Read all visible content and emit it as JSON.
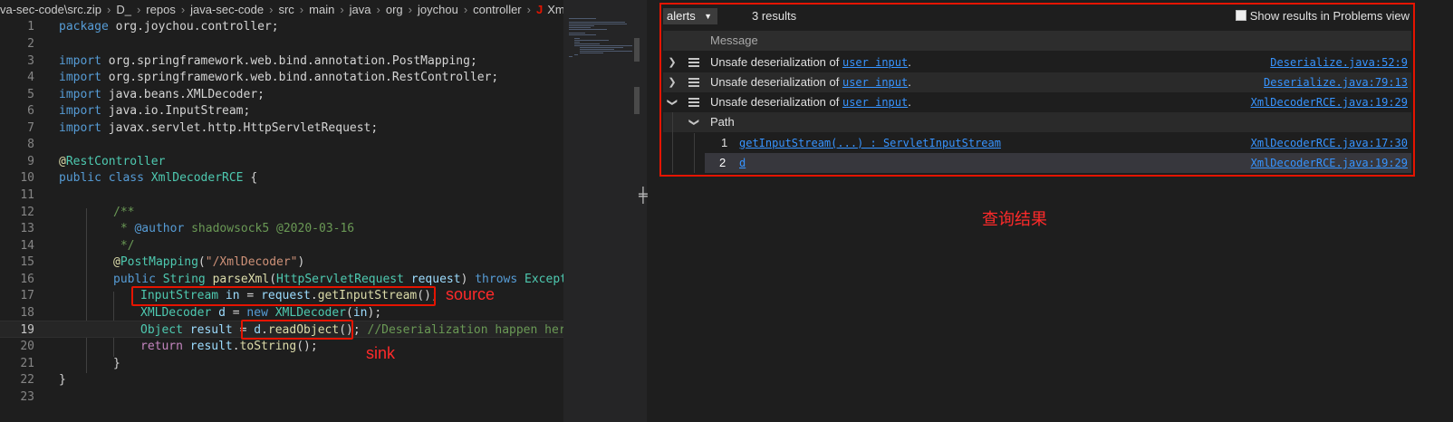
{
  "breadcrumb": {
    "items": [
      "va-sec-code\\src.zip",
      "D_",
      "repos",
      "java-sec-code",
      "src",
      "main",
      "java",
      "org",
      "joychou",
      "controller"
    ],
    "file_icon": "J",
    "file": "XmlDecoderRCE.java"
  },
  "code": {
    "line_numbers": [
      "1",
      "2",
      "3",
      "4",
      "5",
      "6",
      "7",
      "8",
      "9",
      "10",
      "11",
      "12",
      "13",
      "14",
      "15",
      "16",
      "17",
      "18",
      "19",
      "20",
      "21",
      "22",
      "23"
    ],
    "l1": [
      "package",
      " org.joychou.controller;"
    ],
    "l3": [
      "import",
      " org.springframework.web.bind.annotation.PostMapping;"
    ],
    "l4": [
      "import",
      " org.springframework.web.bind.annotation.RestController;"
    ],
    "l5": [
      "import",
      " java.beans.XMLDecoder;"
    ],
    "l6": [
      "import",
      " java.io.InputStream;"
    ],
    "l7": [
      "import",
      " javax.servlet.http.HttpServletRequest;"
    ],
    "l9": [
      "@",
      "RestController"
    ],
    "l10": [
      "public",
      " ",
      "class",
      " ",
      "XmlDecoderRCE",
      " {"
    ],
    "l12": "/**",
    "l13": [
      " * ",
      "@author",
      " shadowsock5 @2020-03-16"
    ],
    "l14": " */",
    "l15": [
      "@",
      "PostMapping",
      "(",
      "\"/XmlDecoder\"",
      ")"
    ],
    "l16": [
      "public",
      " ",
      "String",
      " ",
      "parseXml",
      "(",
      "HttpServletRequest",
      " ",
      "request",
      ") ",
      "throws",
      " ",
      "Exception"
    ],
    "l17": [
      "InputStream",
      " ",
      "in",
      " = ",
      "request",
      ".",
      "getInputStream",
      "();"
    ],
    "l18": [
      "XMLDecoder",
      " ",
      "d",
      " = ",
      "new",
      " ",
      "XMLDecoder",
      "(",
      "in",
      ");"
    ],
    "l19": [
      "Object",
      " ",
      "result",
      " = ",
      "d",
      ".",
      "readObject",
      "(); ",
      "//Deserialization happen here"
    ],
    "l20": [
      "return",
      " ",
      "result",
      ".",
      "toString",
      "();"
    ],
    "l21": "}",
    "l22": "}"
  },
  "annotations": {
    "source": "source",
    "sink": "sink",
    "results_caption": "查询结果"
  },
  "results": {
    "dropdown_value": "alerts",
    "count": "3 results",
    "problems_label": "Show results in Problems view",
    "column_header": "Message",
    "alerts": [
      {
        "prefix": "Unsafe deserialization of ",
        "link": "user input",
        "suffix": ".",
        "location": "Deserialize.java:52:9"
      },
      {
        "prefix": "Unsafe deserialization of ",
        "link": "user input",
        "suffix": ".",
        "location": "Deserialize.java:79:13"
      },
      {
        "prefix": "Unsafe deserialization of ",
        "link": "user input",
        "suffix": ".",
        "location": "XmlDecoderRCE.java:19:29"
      }
    ],
    "path_label": "Path",
    "path_steps": [
      {
        "num": "1",
        "text": "getInputStream(...) : ServletInputStream",
        "location": "XmlDecoderRCE.java:17:30"
      },
      {
        "num": "2",
        "text": "d",
        "location": "XmlDecoderRCE.java:19:29"
      }
    ]
  },
  "colors": {
    "highlight_red": "#e51400",
    "link_blue": "#3794ff",
    "keyword": "#569cd6",
    "type": "#4ec9b0"
  }
}
